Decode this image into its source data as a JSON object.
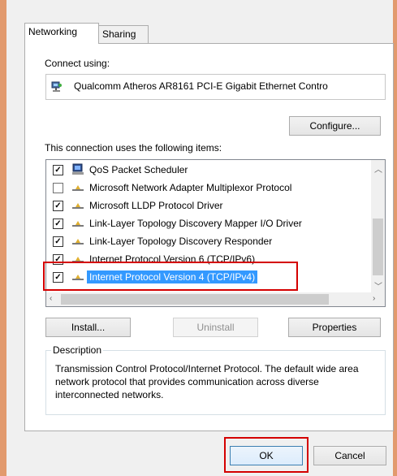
{
  "tabs": [
    {
      "label": "Networking",
      "active": true
    },
    {
      "label": "Sharing",
      "active": false
    }
  ],
  "connect_using_label": "Connect using:",
  "adapter_name": "Qualcomm Atheros AR8161 PCI-E Gigabit Ethernet Contro",
  "configure_label": "Configure...",
  "items_label": "This connection uses the following items:",
  "items": [
    {
      "label": "QoS Packet Scheduler",
      "checked": true,
      "icon": "qos-scheduler-icon"
    },
    {
      "label": "Microsoft Network Adapter Multiplexor Protocol",
      "checked": false,
      "icon": "network-protocol-icon"
    },
    {
      "label": "Microsoft LLDP Protocol Driver",
      "checked": true,
      "icon": "network-protocol-icon"
    },
    {
      "label": "Link-Layer Topology Discovery Mapper I/O Driver",
      "checked": true,
      "icon": "network-protocol-icon"
    },
    {
      "label": "Link-Layer Topology Discovery Responder",
      "checked": true,
      "icon": "network-protocol-icon"
    },
    {
      "label": "Internet Protocol Version 6 (TCP/IPv6)",
      "checked": true,
      "icon": "network-protocol-icon"
    },
    {
      "label": "Internet Protocol Version 4 (TCP/IPv4)",
      "checked": true,
      "icon": "network-protocol-icon",
      "selected": true
    }
  ],
  "install_label": "Install...",
  "uninstall_label": "Uninstall",
  "properties_label": "Properties",
  "description_title": "Description",
  "description_text": "Transmission Control Protocol/Internet Protocol. The default wide area network protocol that provides communication across diverse interconnected networks.",
  "ok_label": "OK",
  "cancel_label": "Cancel",
  "colors": {
    "highlight": "#d40000",
    "selection": "#3399ff"
  }
}
